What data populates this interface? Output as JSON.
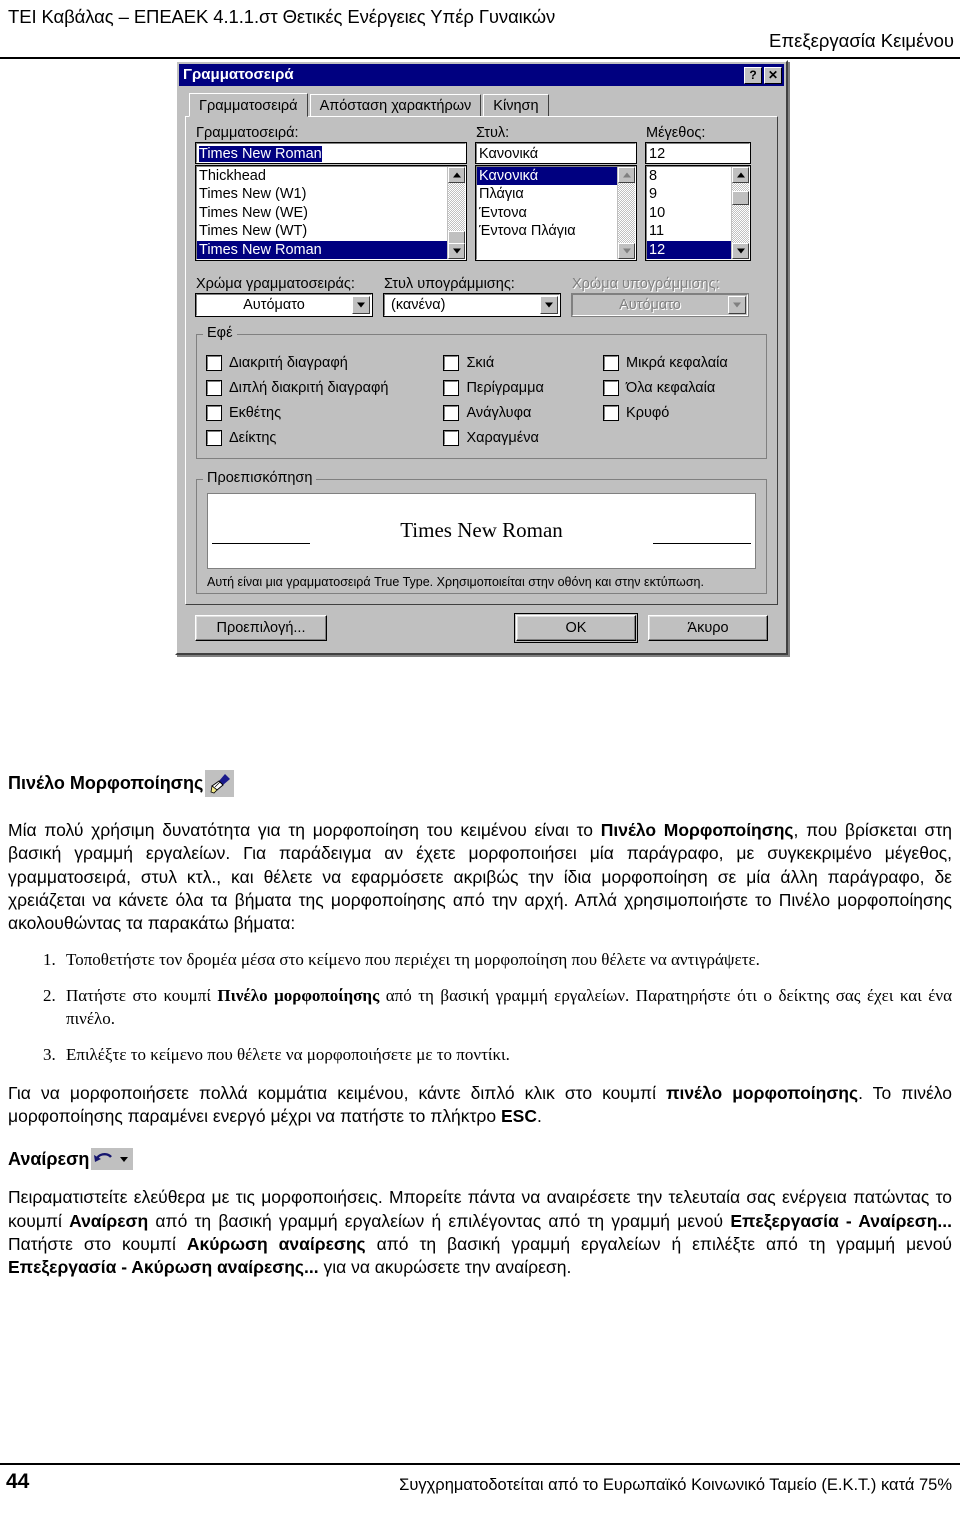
{
  "header": {
    "left": "ΤΕΙ Καβάλας – ΕΠΕΑΕΚ 4.1.1.στ Θετικές Ενέργειες Υπέρ Γυναικών",
    "right": "Επεξεργασία Κειμένου"
  },
  "dialog": {
    "title": "Γραμματοσειρά",
    "help_button": "?",
    "close_button": "✕",
    "tabs": [
      {
        "label": "Γραμματοσειρά",
        "active": true
      },
      {
        "label": "Απόσταση χαρακτήρων",
        "active": false
      },
      {
        "label": "Κίνηση",
        "active": false
      }
    ],
    "font": {
      "label": "Γραμματοσειρά:",
      "value": "Times New Roman",
      "items": [
        "Thickhead",
        "Times New (W1)",
        "Times New (WE)",
        "Times New (WT)",
        "Times New Roman"
      ],
      "selected_index": 4
    },
    "style": {
      "label": "Στυλ:",
      "value": "Κανονικά",
      "items": [
        "Κανονικά",
        "Πλάγια",
        "Έντονα",
        "Έντονα Πλάγια"
      ],
      "selected_index": 0
    },
    "size": {
      "label": "Μέγεθος:",
      "value": "12",
      "items": [
        "8",
        "9",
        "10",
        "11",
        "12"
      ],
      "selected_index": 4
    },
    "font_color": {
      "label": "Χρώμα γραμματοσειράς:",
      "value": "Αυτόματο"
    },
    "underline_style": {
      "label": "Στυλ υπογράμμισης:",
      "value": "(κανένα)"
    },
    "underline_color": {
      "label": "Χρώμα υπογράμμισης:",
      "value": "Αυτόματο",
      "disabled": true
    },
    "effects": {
      "title": "Εφέ",
      "col1": [
        {
          "label": "Διακριτή διαγραφή",
          "checked": false
        },
        {
          "label": "Διπλή διακριτή διαγραφή",
          "checked": false
        },
        {
          "label": "Εκθέτης",
          "checked": false
        },
        {
          "label": "Δείκτης",
          "checked": false
        }
      ],
      "col2": [
        {
          "label": "Σκιά",
          "checked": false
        },
        {
          "label": "Περίγραμμα",
          "checked": false
        },
        {
          "label": "Ανάγλυφα",
          "checked": false
        },
        {
          "label": "Χαραγμένα",
          "checked": false
        }
      ],
      "col3": [
        {
          "label": "Μικρά κεφαλαία",
          "checked": false
        },
        {
          "label": "Όλα κεφαλαία",
          "checked": false
        },
        {
          "label": "Κρυφό",
          "checked": false
        }
      ]
    },
    "preview": {
      "title": "Προεπισκόπηση",
      "sample": "Times New Roman",
      "note": "Αυτή είναι μια γραμματοσειρά True Type. Χρησιμοποιείται στην οθόνη και στην εκτύπωση."
    },
    "buttons": {
      "default": "Προεπιλογή...",
      "ok": "OK",
      "cancel": "Άκυρο"
    }
  },
  "doc": {
    "section1_title": "Πινέλο Μορφοποίησης",
    "section1_icon": "paintbrush-icon",
    "para1_a": "Μία πολύ χρήσιμη δυνατότητα για τη μορφοποίηση του κειμένου είναι το ",
    "para1_b": "Πινέλο Μορφοποίησης",
    "para1_c": ", που βρίσκεται στη βασική γραμμή εργαλείων. Για παράδειγμα αν έχετε μορφοποιήσει μία παράγραφο, με συγκεκριμένο μέγεθος, γραμματοσειρά, στυλ κτλ., και θέλετε να εφαρμόσετε ακριβώς την ίδια μορφοποίηση σε μία άλλη παράγραφο, δε χρειάζεται να κάνετε όλα τα βήματα της μορφοποίησης από την αρχή. Απλά χρησιμοποιήστε το Πινέλο μορφοποίησης ακολουθώντας τα παρακάτω βήματα:",
    "step1": "Τοποθετήστε τον δρομέα μέσα στο κείμενο που περιέχει τη μορφοποίηση που θέλετε να αντιγράψετε.",
    "step2_a": "Πατήστε στο κουμπί ",
    "step2_b": "Πινέλο μορφοποίησης",
    "step2_c": " από τη βασική γραμμή εργαλείων. Παρατηρήστε ότι ο δείκτης σας έχει και ένα πινέλο.",
    "step3": "Επιλέξτε το κείμενο που θέλετε να μορφοποιήσετε με το ποντίκι.",
    "para2_a": "Για να μορφοποιήσετε πολλά κομμάτια κειμένου, κάντε διπλό κλικ στο κουμπί ",
    "para2_b": "πινέλο μορφοποίησης",
    "para2_c": ". Το πινέλο μορφοποίησης παραμένει ενεργό μέχρι να πατήστε το πλήκτρο ",
    "para2_d": "ESC",
    "para2_e": ".",
    "section2_title": "Αναίρεση",
    "section2_icon": "undo-icon",
    "para3_a": "Πειραματιστείτε ελεύθερα με τις μορφοποιήσεις. Μπορείτε πάντα να αναιρέσετε την τελευταία σας ενέργεια πατώντας το κουμπί ",
    "para3_b": "Αναίρεση",
    "para3_c": " από τη βασική γραμμή εργαλείων ή επιλέγοντας από τη γραμμή μενού ",
    "para3_d": "Επεξεργασία - Αναίρεση...",
    "para3_e": " Πατήστε στο κουμπί ",
    "para3_f": "Ακύρωση αναίρεσης",
    "para3_g": " από τη βασική γραμμή εργαλείων ή επιλέξτε από τη γραμμή μενού ",
    "para3_h": "Επεξεργασία - Ακύρωση αναίρεσης...",
    "para3_i": " για να ακυρώσετε την αναίρεση."
  },
  "footer": {
    "page": "44",
    "text": "Συγχρηματοδοτείται από το Ευρωπαϊκό Κοινωνικό Ταμείο (Ε.Κ.Τ.) κατά 75%"
  },
  "colors": {
    "titlebar": "#000080",
    "dialog_face": "#c0c0c0",
    "selection": "#000080",
    "disabled_text": "#808080"
  }
}
